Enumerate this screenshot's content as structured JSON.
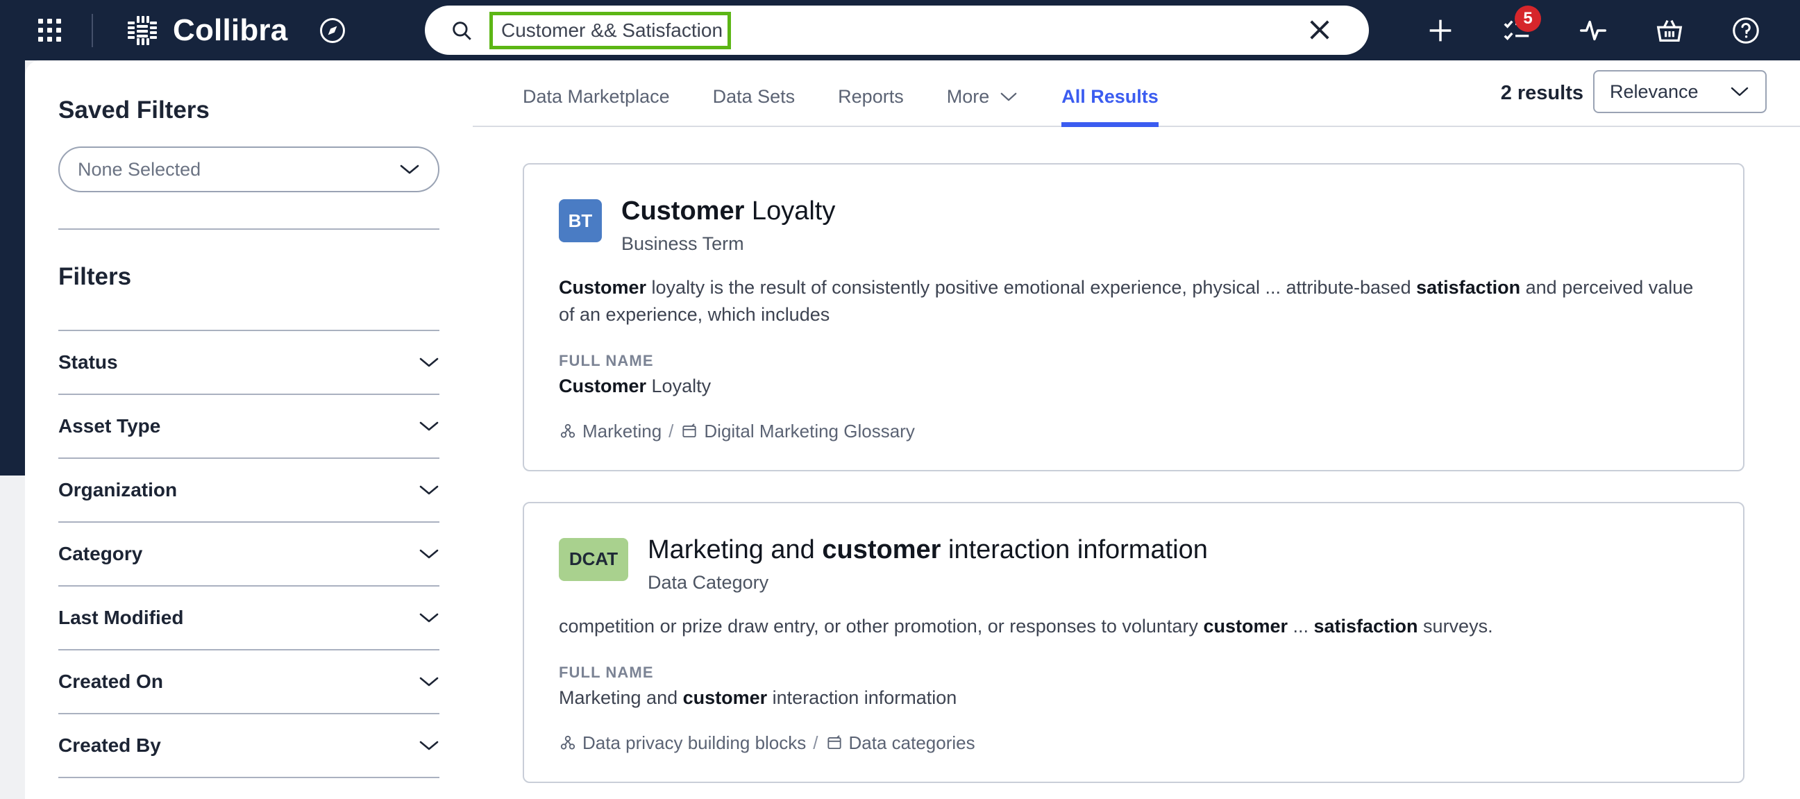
{
  "header": {
    "brand": "Collibra",
    "icons": {
      "apps": "apps-grid-icon",
      "logo": "collibra-logo-icon",
      "compass": "compass-icon",
      "search": "search-icon",
      "clear": "close-icon",
      "add": "plus-icon",
      "tasks": "task-list-icon",
      "activity": "activity-pulse-icon",
      "basket": "basket-icon",
      "help": "help-circle-icon"
    },
    "tasks_badge": "5"
  },
  "search": {
    "value": "Customer && Satisfaction",
    "placeholder": "Search",
    "highlight_color": "#5cb615"
  },
  "sidebar": {
    "saved_filters_title": "Saved Filters",
    "saved_filters_value": "None Selected",
    "filters_title": "Filters",
    "filters": [
      {
        "label": "Status"
      },
      {
        "label": "Asset Type"
      },
      {
        "label": "Organization"
      },
      {
        "label": "Category"
      },
      {
        "label": "Last Modified"
      },
      {
        "label": "Created On"
      },
      {
        "label": "Created By"
      }
    ]
  },
  "main": {
    "tabs": [
      {
        "label": "Data Marketplace",
        "active": false,
        "caret": false
      },
      {
        "label": "Data Sets",
        "active": false,
        "caret": false
      },
      {
        "label": "Reports",
        "active": false,
        "caret": false
      },
      {
        "label": "More",
        "active": false,
        "caret": true
      },
      {
        "label": "All Results",
        "active": true,
        "caret": false
      }
    ],
    "results_count": "2 results",
    "sort_value": "Relevance",
    "full_name_label": "FULL NAME",
    "accent_color": "#3b5cf0",
    "results": [
      {
        "badge": "BT",
        "badge_style": "bt",
        "badge_color": "#4a7cc4",
        "title_bold": "Customer",
        "title_rest": " Loyalty",
        "subtype": "Business Term",
        "desc_parts": [
          {
            "t": "Customer",
            "b": true
          },
          {
            "t": " loyalty is the result of consistently positive emotional experience, physical ... attribute-based ",
            "b": false
          },
          {
            "t": "satisfaction",
            "b": true
          },
          {
            "t": " and perceived value of an experience, which includes",
            "b": false
          }
        ],
        "full_name_parts": [
          {
            "t": "Customer",
            "b": true
          },
          {
            "t": " Loyalty",
            "b": false
          }
        ],
        "crumb_domain": "Marketing",
        "crumb_community": "Digital Marketing Glossary"
      },
      {
        "badge": "DCAT",
        "badge_style": "dcat",
        "badge_color": "#a9d18e",
        "title_bold": "customer",
        "title_prefix": "Marketing and ",
        "title_rest": " interaction information",
        "subtype": "Data Category",
        "desc_parts": [
          {
            "t": "competition or prize draw entry, or other promotion, or responses to voluntary ",
            "b": false
          },
          {
            "t": "customer",
            "b": true
          },
          {
            "t": " ... ",
            "b": false
          },
          {
            "t": "satisfaction",
            "b": true
          },
          {
            "t": " surveys.",
            "b": false
          }
        ],
        "full_name_parts": [
          {
            "t": "Marketing and ",
            "b": false
          },
          {
            "t": "customer",
            "b": true
          },
          {
            "t": " interaction information",
            "b": false
          }
        ],
        "crumb_domain": "Data privacy building blocks",
        "crumb_community": "Data categories"
      }
    ]
  }
}
